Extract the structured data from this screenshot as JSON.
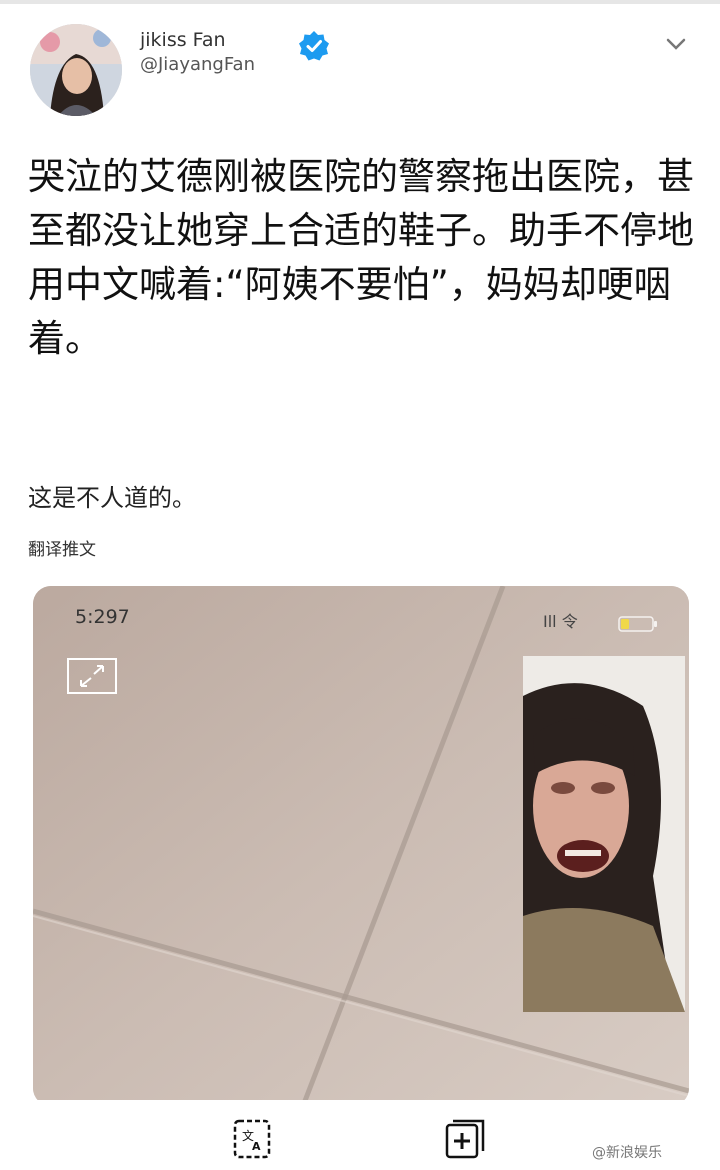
{
  "tweet": {
    "author_display_name": "jikiss Fan",
    "author_handle": "@JiayangFan",
    "verified": true,
    "text": "哭泣的艾德刚被医院的警察拖出医院，甚至都没让她穿上合适的鞋子。助手不停地用中文喊着:“阿姨不要怕”，妈妈却哽咽着。",
    "text_2": "这是不人道的。",
    "translate_link": "翻译推文"
  },
  "media": {
    "status_time": "5:297",
    "status_icons": "Ill 令",
    "minimize_icon": "collapse-arrows-icon"
  },
  "bottom_bar": {
    "watermark": "@新浪娱乐"
  },
  "colors": {
    "verified_badge": "#1d9bf0",
    "call_background": "#c9bbb2",
    "battery_level": "#f0d84a"
  }
}
